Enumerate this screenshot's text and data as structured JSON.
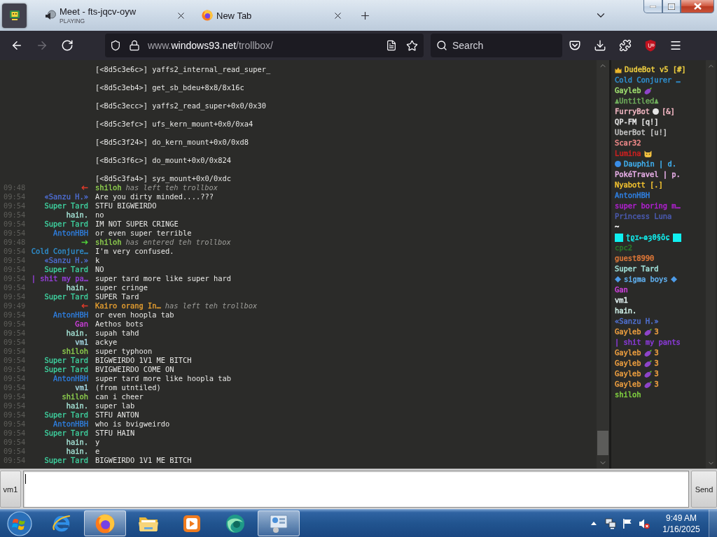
{
  "browser": {
    "tabs": [
      {
        "kind": "pinned",
        "selected": true
      },
      {
        "kind": "media",
        "title": "Meet - fts-jqcv-oyw",
        "subtitle": "PLAYING",
        "selected": false
      },
      {
        "kind": "newtab",
        "title": "New Tab",
        "selected": false
      }
    ],
    "nav_buttons": [
      {
        "kind": "back",
        "disabled": false
      },
      {
        "kind": "forward",
        "disabled": true
      },
      {
        "kind": "reload",
        "disabled": false
      }
    ],
    "address": {
      "prefix": "www.",
      "domain": "windows93.net",
      "path": "/trollbox/"
    },
    "search": {
      "placeholder": "Search"
    }
  },
  "trollbox": {
    "messages": [
      {
        "kind": "code",
        "text": "[<8d5c3e6c>] yaffs2_internal_read_super_"
      },
      {
        "kind": "code",
        "text": "[<8d5c3eb4>] get_sb_bdeu+8x8/8x16c"
      },
      {
        "kind": "code",
        "text": "[<Bd5c3ecc>] yaffs2_read_super+0x0/0x30"
      },
      {
        "kind": "code",
        "text": "[<8d5c3efc>] ufs_kern_mount+0x0/0xa4"
      },
      {
        "kind": "code",
        "text": "[<Bd5c3f24>] do_kern_mount+0x0/0xd8"
      },
      {
        "kind": "code",
        "text": "[<Bd5c3f6c>] do_mount+0x0/0x824"
      },
      {
        "kind": "code",
        "text": "[<8d5c3fa4>] sys_mount+0x0/0xdc"
      },
      {
        "kind": "leave",
        "time": "09:48",
        "nick": "shiloh",
        "color": "#8fd14f",
        "text": "has left teh trollbox"
      },
      {
        "kind": "message",
        "time": "09:54",
        "nick": "«Sanzu H.»",
        "color": "#4f6fd6",
        "text": "Are you dirty minded....???"
      },
      {
        "kind": "message",
        "time": "09:54",
        "nick": "Super Tard",
        "color": "#3fd3a0",
        "text": "STFU BIGWEIRDO"
      },
      {
        "kind": "message",
        "time": "09:54",
        "nick": "hain.",
        "color": "#a6e3d6",
        "text": "no"
      },
      {
        "kind": "message",
        "time": "09:54",
        "nick": "Super Tard",
        "color": "#3fd3a0",
        "text": "IM NOT SUPER CRINGE"
      },
      {
        "kind": "message",
        "time": "09:54",
        "nick": "AntonHBH",
        "color": "#2f7fe0",
        "text": "or even super terrible"
      },
      {
        "kind": "join",
        "time": "09:48",
        "nick": "shiloh",
        "color": "#8fd14f",
        "text": "has entered teh trollbox"
      },
      {
        "kind": "message",
        "time": "09:54",
        "nick": "Cold Conjure…",
        "color": "#2f90d0",
        "text": "I'm very confused."
      },
      {
        "kind": "message",
        "time": "09:54",
        "nick": "«Sanzu H.»",
        "color": "#4f6fd6",
        "text": "k"
      },
      {
        "kind": "message",
        "time": "09:54",
        "nick": "Super Tard",
        "color": "#3fd3a0",
        "text": "NO"
      },
      {
        "kind": "message",
        "time": "09:54",
        "nick": "| shit my pa…",
        "color": "#9a40e0",
        "text": "super tard more like super hard"
      },
      {
        "kind": "message",
        "time": "09:54",
        "nick": "hain.",
        "color": "#a6e3d6",
        "text": "super cringe"
      },
      {
        "kind": "message",
        "time": "09:54",
        "nick": "Super Tard",
        "color": "#3fd3a0",
        "text": "SUPER Tard"
      },
      {
        "kind": "leave",
        "time": "09:49",
        "nick": "Kairo orang In…",
        "color": "#e8a030",
        "text": "has left teh trollbox"
      },
      {
        "kind": "message",
        "time": "09:54",
        "nick": "AntonHBH",
        "color": "#2f7fe0",
        "text": "or even hoopla tab"
      },
      {
        "kind": "message",
        "time": "09:54",
        "nick": "Gan",
        "color": "#d040e0",
        "text": "Aethos bots"
      },
      {
        "kind": "message",
        "time": "09:54",
        "nick": "hain.",
        "color": "#a6e3d6",
        "text": "supah tahd"
      },
      {
        "kind": "message",
        "time": "09:54",
        "nick": "vm1",
        "color": "#a8dce8",
        "text": "ackye"
      },
      {
        "kind": "message",
        "time": "09:54",
        "nick": "shiloh",
        "color": "#8fd14f",
        "text": "super typhoon"
      },
      {
        "kind": "message",
        "time": "09:54",
        "nick": "Super Tard",
        "color": "#3fd3a0",
        "text": "BIGWEIRDO 1V1 ME BITCH"
      },
      {
        "kind": "message",
        "time": "09:54",
        "nick": "Super Tard",
        "color": "#3fd3a0",
        "text": "BVIGWEIRDO COME ON"
      },
      {
        "kind": "message",
        "time": "09:54",
        "nick": "AntonHBH",
        "color": "#2f7fe0",
        "text": "super tard more like hoopla tab"
      },
      {
        "kind": "message",
        "time": "09:54",
        "nick": "vm1",
        "color": "#a8dce8",
        "text": "(from utntiled)"
      },
      {
        "kind": "message",
        "time": "09:54",
        "nick": "shiloh",
        "color": "#8fd14f",
        "text": "can i cheer"
      },
      {
        "kind": "message",
        "time": "09:54",
        "nick": "hain.",
        "color": "#a6e3d6",
        "text": "super lab"
      },
      {
        "kind": "message",
        "time": "09:54",
        "nick": "Super Tard",
        "color": "#3fd3a0",
        "text": "STFU ANTON"
      },
      {
        "kind": "message",
        "time": "09:54",
        "nick": "AntonHBH",
        "color": "#2f7fe0",
        "text": "who is bvigweirdo"
      },
      {
        "kind": "message",
        "time": "09:54",
        "nick": "Super Tard",
        "color": "#3fd3a0",
        "text": "STFU HAIN"
      },
      {
        "kind": "message",
        "time": "09:54",
        "nick": "hain.",
        "color": "#a6e3d6",
        "text": "y"
      },
      {
        "kind": "message",
        "time": "09:54",
        "nick": "hain.",
        "color": "#a6e3d6",
        "text": "e"
      },
      {
        "kind": "message",
        "time": "09:54",
        "nick": "Super Tard",
        "color": "#3fd3a0",
        "text": "BIGWEIRDO 1V1 ME BITCH"
      }
    ],
    "users": [
      {
        "kind": "crown",
        "name": "DudeBot v5 [#]",
        "color": "#f0d040"
      },
      {
        "kind": "plain",
        "name": "Cold Conjurer …",
        "color": "#2f90d0"
      },
      {
        "kind": "eggplant",
        "name": "Gayleb",
        "color": "#a0e070"
      },
      {
        "kind": "plain",
        "name": "♟Untitled♟",
        "color": "#6fae5c"
      },
      {
        "kind": "circle",
        "name": "FurryBot",
        "suffix": "[&]",
        "color": "#f4b8c4"
      },
      {
        "kind": "plain",
        "name": "QP-FM [q!]",
        "color": "#e6e6e6"
      },
      {
        "kind": "plain",
        "name": "UberBot [u!]",
        "color": "#c4c4c4"
      },
      {
        "kind": "plain",
        "name": "Scar32",
        "color": "#f08a8a"
      },
      {
        "kind": "cat",
        "name": "Lumina",
        "color": "#d02020"
      },
      {
        "kind": "dot",
        "name": "Dauphin | d.",
        "color": "#40b0f0"
      },
      {
        "kind": "plain",
        "name": "PokéTravel | p.",
        "color": "#eab0ea"
      },
      {
        "kind": "plain",
        "name": "Nyabott [.]",
        "color": "#f0c030"
      },
      {
        "kind": "plain",
        "name": "AntonHBH",
        "color": "#2f7fe0"
      },
      {
        "kind": "plain",
        "name": "super boring m…",
        "color": "#b020d0"
      },
      {
        "kind": "plain",
        "name": "Princess Luna",
        "color": "#4a5ab0"
      },
      {
        "kind": "plain",
        "name": "~",
        "color": "#ffffff"
      },
      {
        "kind": "block",
        "name": "ʈϱɪ←ɷȝ0§ôɕ",
        "color": "#10f0f0"
      },
      {
        "kind": "plain",
        "name": "cpc2",
        "color": "#2a7a2a"
      },
      {
        "kind": "plain",
        "name": "guest8990",
        "color": "#e07838"
      },
      {
        "kind": "plain",
        "name": "Super Tard",
        "color": "#a0e0d8"
      },
      {
        "kind": "diamond",
        "name": "sigma boys",
        "color": "#60b0f0"
      },
      {
        "kind": "plain",
        "name": "Gan",
        "color": "#d040e0"
      },
      {
        "kind": "plain",
        "name": "vm1",
        "color": "#e0f0f0"
      },
      {
        "kind": "plain",
        "name": "hain.",
        "color": "#d0f0e8"
      },
      {
        "kind": "plain",
        "name": "«Sanzu H.»",
        "color": "#5070d0"
      },
      {
        "kind": "eggplant",
        "name": "Gayleb",
        "suffix": "3",
        "color": "#f0a040"
      },
      {
        "kind": "plain",
        "name": "| shit my pants",
        "color": "#8a3ad8"
      },
      {
        "kind": "eggplant",
        "name": "Gayleb",
        "suffix": "3",
        "color": "#f0a040"
      },
      {
        "kind": "eggplant",
        "name": "Gayleb",
        "suffix": "3",
        "color": "#f0a040"
      },
      {
        "kind": "eggplant",
        "name": "Gayleb",
        "suffix": "3",
        "color": "#f0a040"
      },
      {
        "kind": "eggplant",
        "name": "Gayleb",
        "suffix": "3",
        "color": "#f0a040"
      },
      {
        "kind": "plain",
        "name": "shiloh",
        "color": "#80d040"
      }
    ],
    "input": {
      "nick": "vm1",
      "send_label": "Send"
    }
  },
  "taskbar": {
    "apps": [
      {
        "kind": "ie",
        "active": false
      },
      {
        "kind": "browser",
        "active": true
      },
      {
        "kind": "folder",
        "active": false
      },
      {
        "kind": "media",
        "active": false
      },
      {
        "kind": "sphere",
        "active": false
      },
      {
        "kind": "panel",
        "active": true
      }
    ],
    "clock": {
      "time": "9:49 AM",
      "date": "1/16/2025"
    }
  }
}
